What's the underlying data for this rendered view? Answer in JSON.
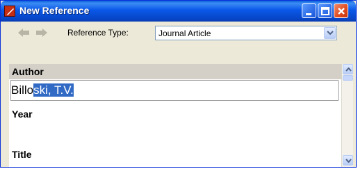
{
  "window": {
    "title": "New Reference"
  },
  "toolbar": {
    "reference_type_label": "Reference Type:",
    "reference_type_value": "Journal Article"
  },
  "fields": {
    "author": {
      "label": "Author",
      "value_unselected": "Billo",
      "value_selected": "ski, T.V."
    },
    "year": {
      "label": "Year"
    },
    "title": {
      "label": "Title"
    }
  },
  "colors": {
    "titlebar": "#0a58e8",
    "selection": "#316ac5",
    "close_button": "#e04a1e"
  }
}
